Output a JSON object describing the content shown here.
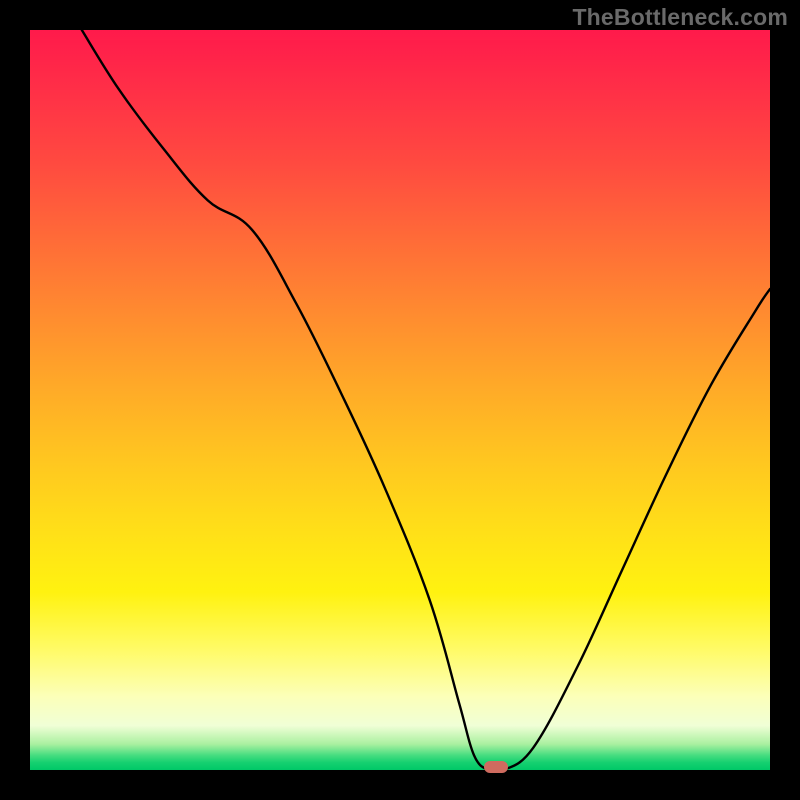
{
  "watermark": "TheBottleneck.com",
  "colors": {
    "background": "#000000",
    "gradient_top": "#ff1a4b",
    "gradient_mid": "#ffe018",
    "gradient_bottom": "#00c867",
    "curve": "#000000",
    "marker": "#cf6b5f",
    "watermark_text": "#6a6a6a"
  },
  "chart_data": {
    "type": "line",
    "title": "",
    "xlabel": "",
    "ylabel": "",
    "xlim": [
      0,
      100
    ],
    "ylim": [
      0,
      100
    ],
    "series": [
      {
        "name": "bottleneck-curve",
        "x": [
          7,
          12,
          18,
          24,
          30,
          36,
          42,
          48,
          54,
          58,
          60,
          62,
          64,
          68,
          74,
          80,
          86,
          92,
          98,
          100
        ],
        "values": [
          100,
          92,
          84,
          77,
          73,
          63,
          51,
          38,
          23,
          9,
          2,
          0,
          0,
          3,
          14,
          27,
          40,
          52,
          62,
          65
        ]
      }
    ],
    "marker": {
      "x": 63,
      "y": 0
    },
    "flat_segment": {
      "x_start": 60,
      "x_end": 65,
      "y": 0
    },
    "note": "Axes hidden (black frame). Background is a vertical heat gradient (red top → green bottom). Curve descends steeply from top-left, flattens near x≈60–65 at y≈0 (minimum), then rises toward upper right. A small rounded marker sits at the curve's minimum on the bottom edge."
  }
}
